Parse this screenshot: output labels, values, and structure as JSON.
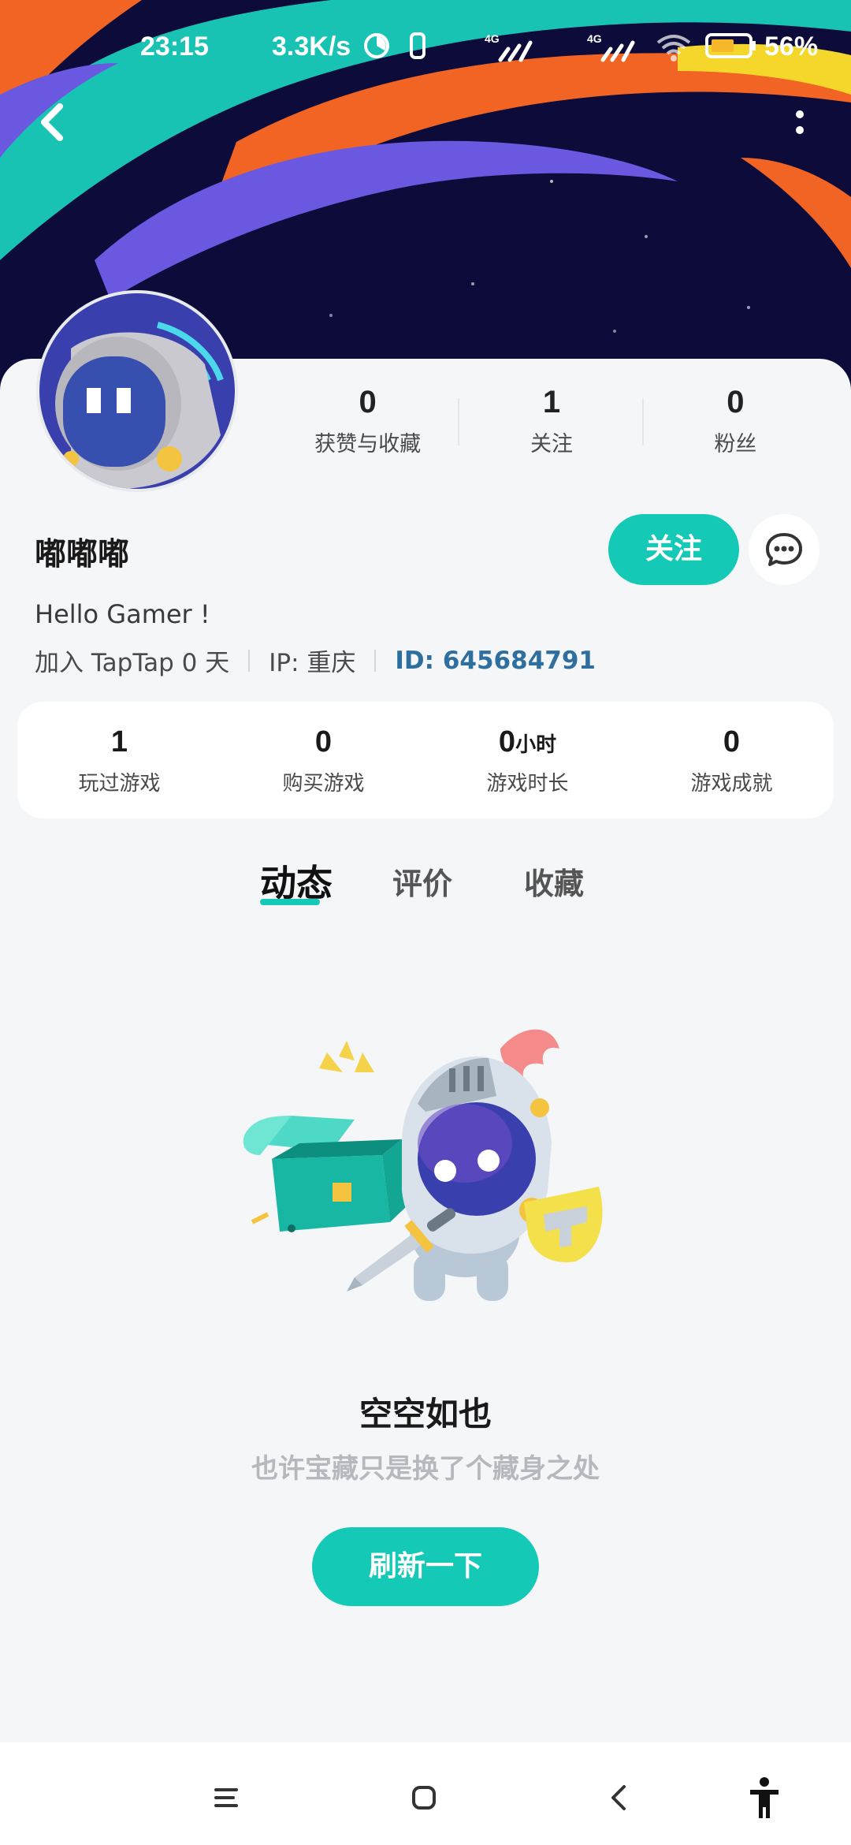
{
  "status_bar": {
    "time": "23:15",
    "speed": "3.3K/s",
    "battery": "56%"
  },
  "profile": {
    "username": "嘟嘟嘟",
    "bio": "Hello Gamer !",
    "join_text": "加入 TapTap 0 天",
    "ip_text": "IP: 重庆",
    "id_text": "ID: 645684791",
    "follow_label": "关注"
  },
  "social_stats": [
    {
      "value": "0",
      "label": "获赞与收藏"
    },
    {
      "value": "1",
      "label": "关注"
    },
    {
      "value": "0",
      "label": "粉丝"
    }
  ],
  "game_stats": [
    {
      "value": "1",
      "unit": "",
      "label": "玩过游戏"
    },
    {
      "value": "0",
      "unit": "",
      "label": "购买游戏"
    },
    {
      "value": "0",
      "unit": "小时",
      "label": "游戏时长"
    },
    {
      "value": "0",
      "unit": "",
      "label": "游戏成就"
    }
  ],
  "tabs": [
    {
      "label": "动态",
      "active": true
    },
    {
      "label": "评价",
      "active": false
    },
    {
      "label": "收藏",
      "active": false
    }
  ],
  "empty_state": {
    "title": "空空如也",
    "subtitle": "也许宝藏只是换了个藏身之处",
    "refresh_label": "刷新一下"
  },
  "icons": {
    "back": "back-arrow-icon",
    "more": "more-vertical-icon",
    "message": "chat-bubble-icon",
    "nav_menu": "menu-icon",
    "nav_home": "home-icon",
    "nav_back": "back-icon",
    "nav_accessibility": "accessibility-icon"
  },
  "colors": {
    "accent": "#15c9b7",
    "id_text": "#2f6fa0",
    "banner_bg": "#0c0b3a"
  }
}
